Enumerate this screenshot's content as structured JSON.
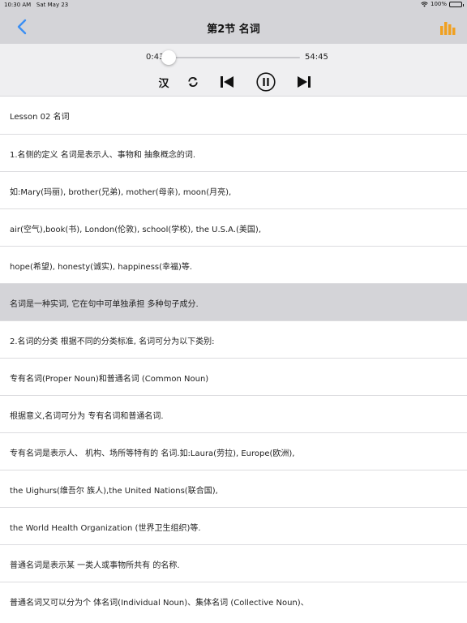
{
  "status": {
    "time": "10:30 AM",
    "date": "Sat May 23",
    "battery": "100%"
  },
  "nav": {
    "title": "第2节 名词"
  },
  "player": {
    "current_time": "0:43",
    "total_time": "54:45",
    "progress": 0.0135,
    "language_toggle": "汉"
  },
  "lines": [
    {
      "text": "Lesson 02 名词"
    },
    {
      "text": "1.名侧的定义 名词是表示人、事物和 抽象概念的词."
    },
    {
      "text": "如:Mary(玛丽), brother(兄弟), mother(母亲), moon(月亮),"
    },
    {
      "text": "air(空气),book(书), London(伦敦), school(学校), the U.S.A.(美国),"
    },
    {
      "text": "hope(希望), honesty(诚实), happiness(幸福)等."
    },
    {
      "text": "名词是一种实词, 它在句中可单独承担 多种句子成分.",
      "active": true
    },
    {
      "text": "2.名词的分类 根据不同的分类标准, 名词可分为以下类别:"
    },
    {
      "text": "专有名词(Proper Noun)和普通名词 (Common Noun)"
    },
    {
      "text": "根据意义,名词可分为 专有名词和普通名词."
    },
    {
      "text": "专有名词是表示人、 机构、场所等特有的 名词.如:Laura(劳拉), Europe(欧洲),"
    },
    {
      "text": "the Uighurs(维吾尔 族人),the United Nations(联合国),"
    },
    {
      "text": "the World Health Organization (世界卫生组织)等."
    },
    {
      "text": "普通名词是表示某 一类人或事物所共有 的名称."
    },
    {
      "text": "普通名词又可以分为个 体名词(Individual Noun)、集体名词 (Collective Noun)、"
    }
  ]
}
